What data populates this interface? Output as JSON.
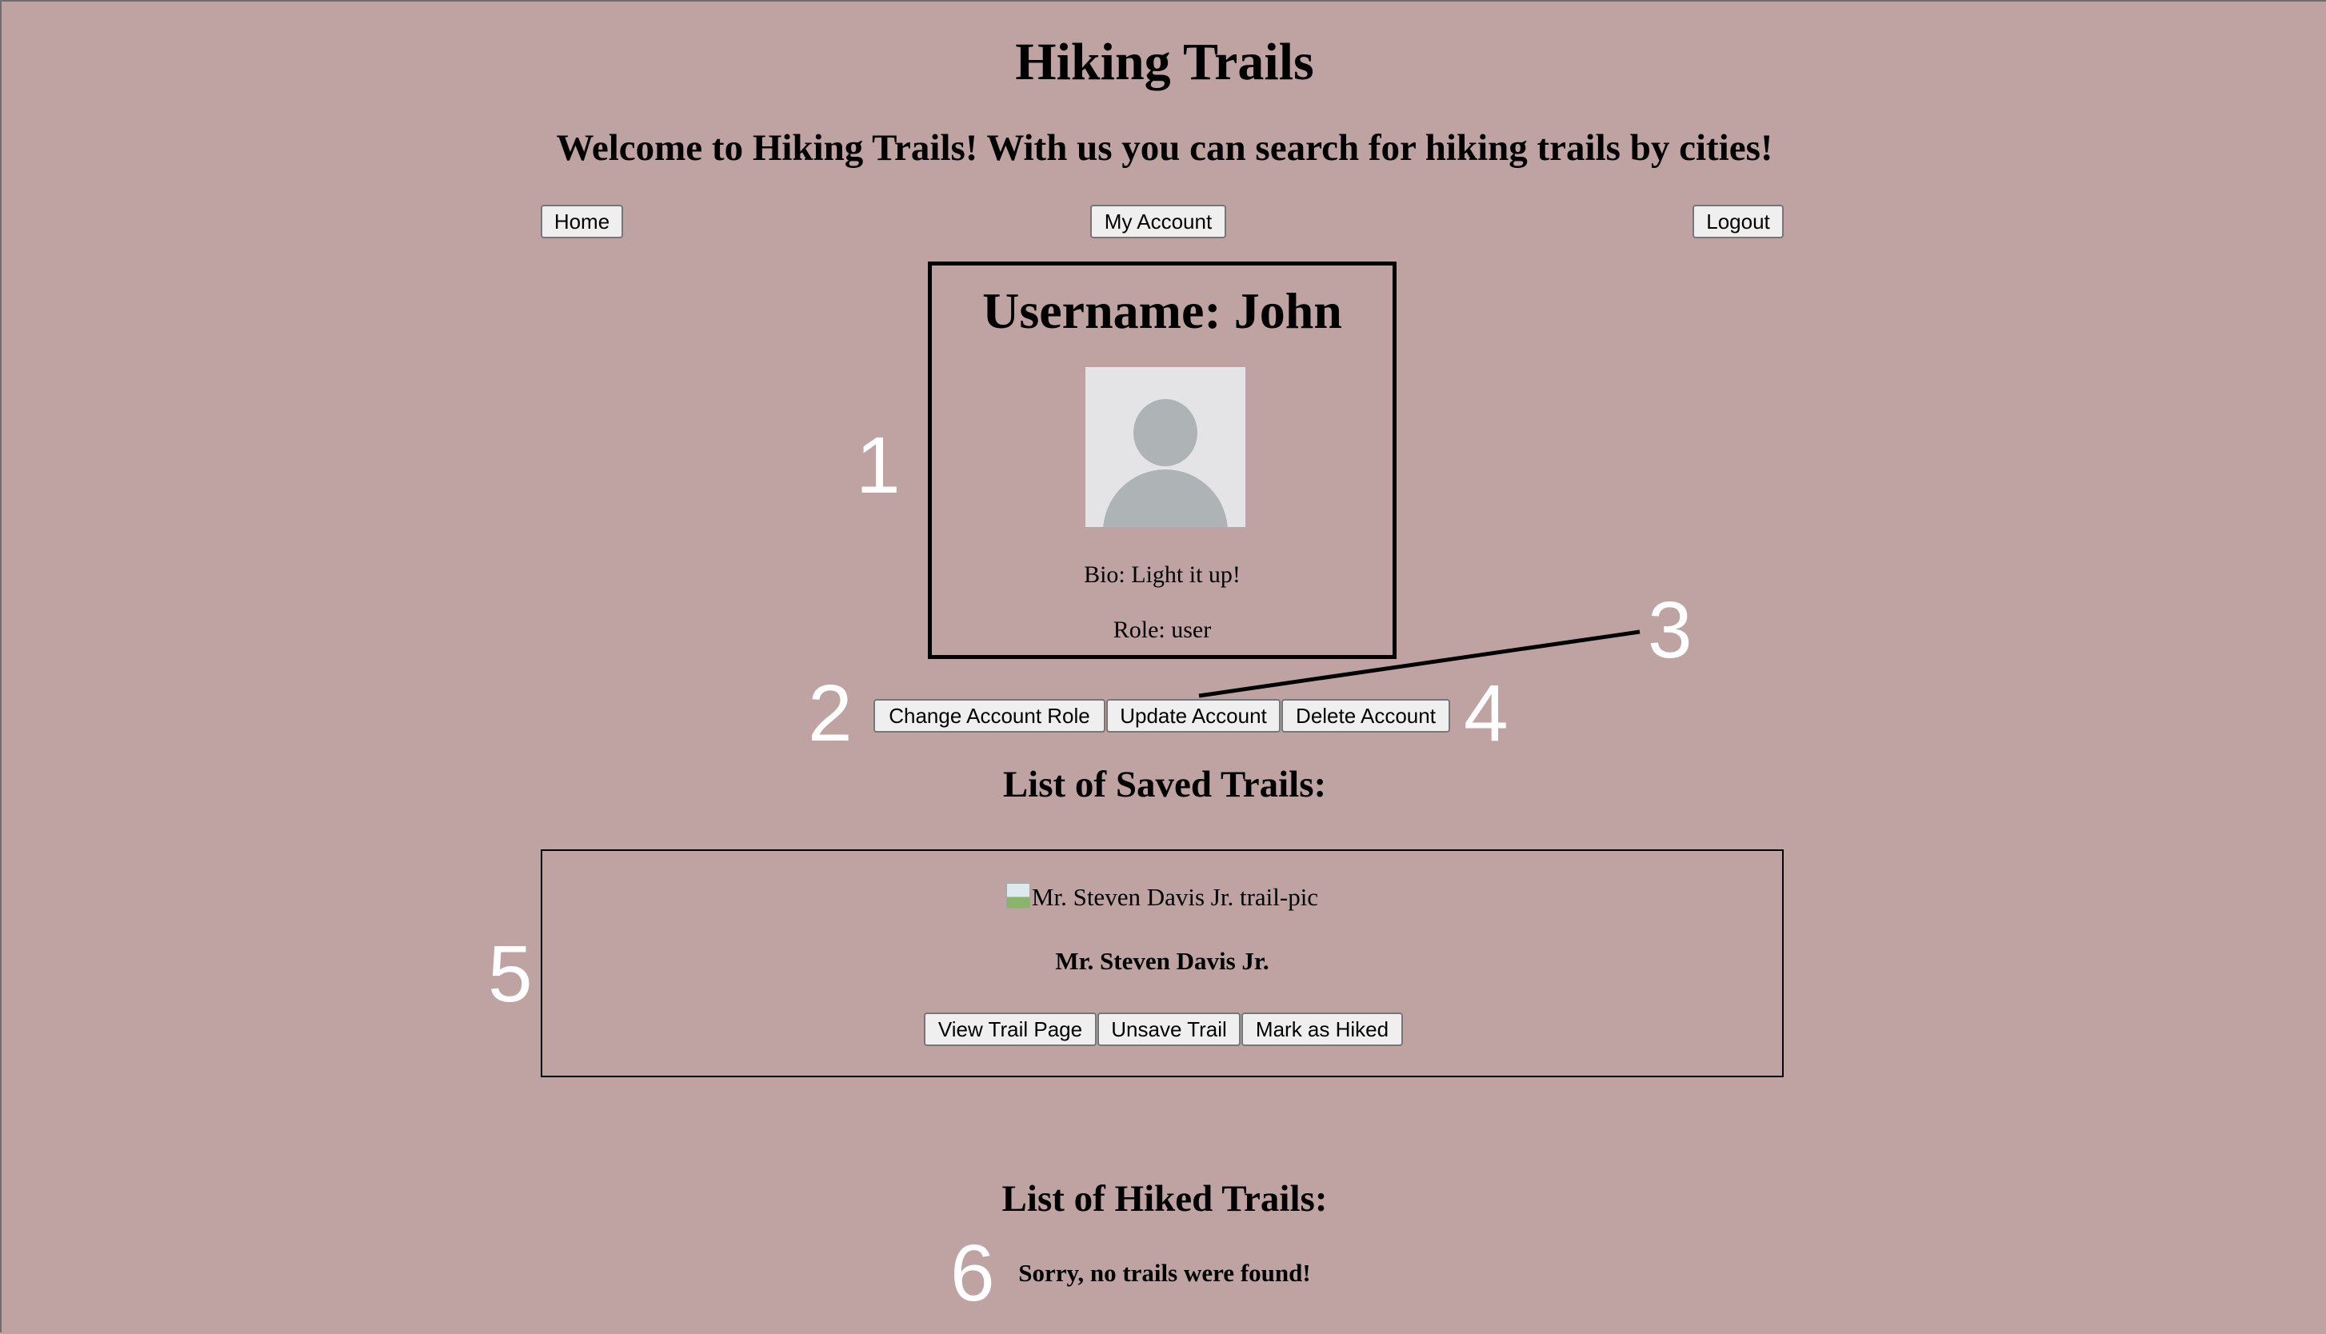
{
  "header": {
    "title": "Hiking Trails",
    "welcome": "Welcome to Hiking Trails! With us you can search for hiking trails by cities!"
  },
  "nav": {
    "home": "Home",
    "my_account": "My Account",
    "logout": "Logout"
  },
  "profile": {
    "username_label": "Username: John",
    "avatar_icon": "default-user-avatar-icon",
    "bio": "Bio: Light it up!",
    "role": "Role: user"
  },
  "account_actions": {
    "change_role": "Change Account Role",
    "update": "Update Account",
    "delete": "Delete Account"
  },
  "saved_trails": {
    "heading": "List of Saved Trails:",
    "items": [
      {
        "image_alt": "Mr. Steven Davis Jr. trail-pic",
        "name": "Mr. Steven Davis Jr.",
        "view_label": "View Trail Page",
        "unsave_label": "Unsave Trail",
        "mark_hiked_label": "Mark as Hiked"
      }
    ]
  },
  "hiked_trails": {
    "heading": "List of Hiked Trails:",
    "empty_message": "Sorry, no trails were found!"
  },
  "annotations": {
    "n1": "1",
    "n2": "2",
    "n3": "3",
    "n4": "4",
    "n5": "5",
    "n6": "6"
  },
  "colors": {
    "page_background": "#bfa3a3",
    "annotation_text": "#ffffff"
  }
}
